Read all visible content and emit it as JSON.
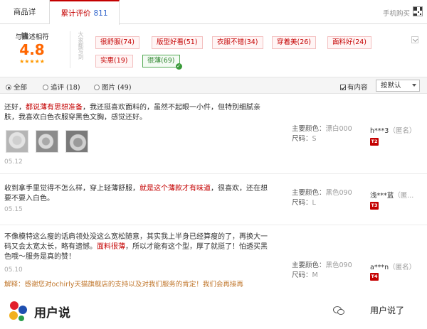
{
  "tabs": {
    "detail_label": "商品详情",
    "reviews_label": "累计评价",
    "reviews_count": "811",
    "mobile_buy": "手机购买"
  },
  "rating": {
    "label": "与描述相符",
    "score": "4.8",
    "stars": "★★★★★",
    "stars_value": 4.8
  },
  "side_vertical_text": "大家都写到",
  "tags": [
    {
      "label": "很舒服(74)"
    },
    {
      "label": "版型好看(51)"
    },
    {
      "label": "衣服不错(34)"
    },
    {
      "label": "穿着美(26)"
    },
    {
      "label": "面料好(24)"
    },
    {
      "label": "实惠(19)"
    },
    {
      "label": "很薄(69)",
      "selected": true
    }
  ],
  "filters": {
    "all": "全部",
    "followup": "追评 (18)",
    "pictures": "图片 (49)",
    "has_content": "有内容",
    "sort": "按默认"
  },
  "reviews": [
    {
      "text_pre": "还好，",
      "text_hl": "都说薄有思想准备",
      "text_post": "，我还挺喜欢面料的，虽然不起眼一小件，但特别细腻亲肤，我喜欢白色衣服穿黑色文胸，感觉还好。",
      "date": "05.12",
      "color_label": "主要颜色：",
      "color_value": "漂白000",
      "size_label": "尺码：",
      "size_value": "S",
      "user": "h***3",
      "anon": "（匿名）",
      "level": "T2"
    },
    {
      "text_pre": "收到拿手里觉得不怎么样，穿上轻薄舒服，",
      "text_hl": "就是这个薄款才有味道",
      "text_post": "，很喜欢，还在想要不要入白色。",
      "date": "05.15",
      "color_label": "主要颜色：",
      "color_value": "黑色090",
      "size_label": "尺码：",
      "size_value": "L",
      "user": "浅***蓝",
      "anon": "（匿...",
      "level": "T3"
    },
    {
      "text_pre": "不像模特这么瘦的话肩领处没这么宽松随意，其实我上半身已经算瘦的了，再换大一码又会太宽太长，略有遗憾。",
      "text_hl": "面料很薄",
      "text_post": "，所以才能有这个型，厚了就挺了！怕透买黑色哦～服务是真的赞！",
      "date": "05.10",
      "color_label": "主要颜色：",
      "color_value": "黑色090",
      "size_label": "尺码：",
      "size_value": "M",
      "user": "a***n",
      "anon": "（匿名）",
      "level": "T4"
    }
  ],
  "explanation": "解释：感谢您对ochirly天猫旗舰店的支持以及对我们服务的肯定！我们会再接再",
  "watermark_left": "用户说",
  "watermark_right": "用户说了"
}
